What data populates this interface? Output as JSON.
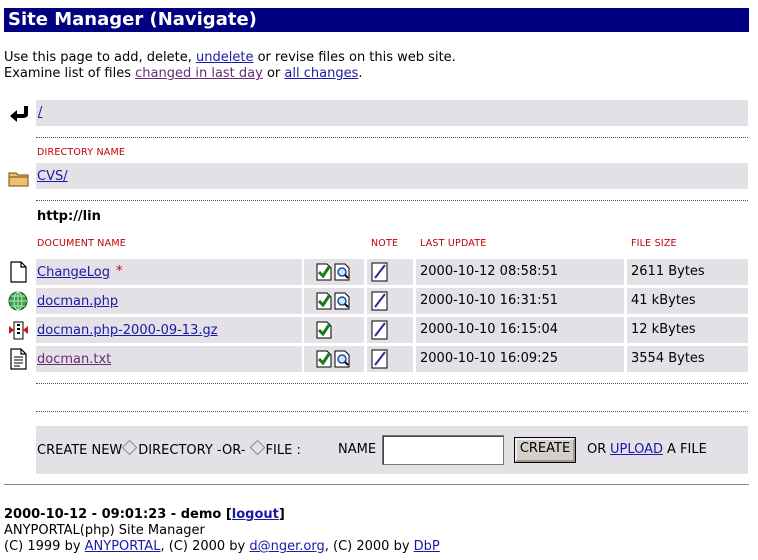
{
  "title": "Site Manager (Navigate)",
  "intro": {
    "line1_pre": "Use this page to add, delete, ",
    "line1_link": "undelete",
    "line1_post": " or revise files on this web site.",
    "line2_pre": "Examine list of files ",
    "line2_link1": "changed in last day",
    "line2_mid": " or ",
    "line2_link2": "all changes",
    "line2_post": "."
  },
  "root_link": "/",
  "dir_header": "DIRECTORY NAME",
  "directories": [
    {
      "name": "CVS/",
      "icon": "folder-icon"
    }
  ],
  "section_url": "http://lin",
  "doc_headers": {
    "name": "DOCUMENT NAME",
    "note": "NOTE",
    "updated": "LAST UPDATE",
    "size": "FILE SIZE"
  },
  "documents": [
    {
      "name": "ChangeLog",
      "marker": "*",
      "icon": "blank-document-icon",
      "updated": "2000-10-12 08:58:51",
      "size": "2611 Bytes",
      "actions": [
        "edit",
        "view"
      ]
    },
    {
      "name": "docman.php",
      "marker": "",
      "icon": "globe-icon",
      "updated": "2000-10-10 16:31:51",
      "size": "41 kBytes",
      "actions": [
        "edit",
        "view"
      ]
    },
    {
      "name": "docman.php-2000-09-13.gz",
      "marker": "",
      "icon": "archive-icon",
      "updated": "2000-10-10 16:15:04",
      "size": "12 kBytes",
      "actions": [
        "edit"
      ]
    },
    {
      "name": "docman.txt",
      "marker": "",
      "icon": "text-document-icon",
      "updated": "2000-10-10 16:09:25",
      "size": "3554 Bytes",
      "actions": [
        "edit",
        "view"
      ]
    }
  ],
  "create": {
    "label": "CREATE NEW",
    "opt_directory": "DIRECTORY -OR-",
    "opt_file": "FILE :",
    "name_label": "NAME",
    "name_value": "",
    "button": "CREATE",
    "or_text": "OR",
    "upload_link": "UPLOAD",
    "upload_post": "A FILE"
  },
  "footer": {
    "status_pre": "2000-10-12 - 09:01:23 - demo [",
    "logout": "logout",
    "status_post": "]",
    "product": "ANYPORTAL(php) Site Manager",
    "copy1": "(C) 1999 by ",
    "link1": "ANYPORTAL",
    "copy2": ", (C) 2000 by ",
    "link2": "d@nger.org",
    "copy3": ", (C) 2000 by ",
    "link3": "DbP"
  },
  "colors": {
    "titlebar": "#000080",
    "row_bg": "#e3e0e6",
    "header_red": "#c00000",
    "link": "#1a1aa6"
  }
}
